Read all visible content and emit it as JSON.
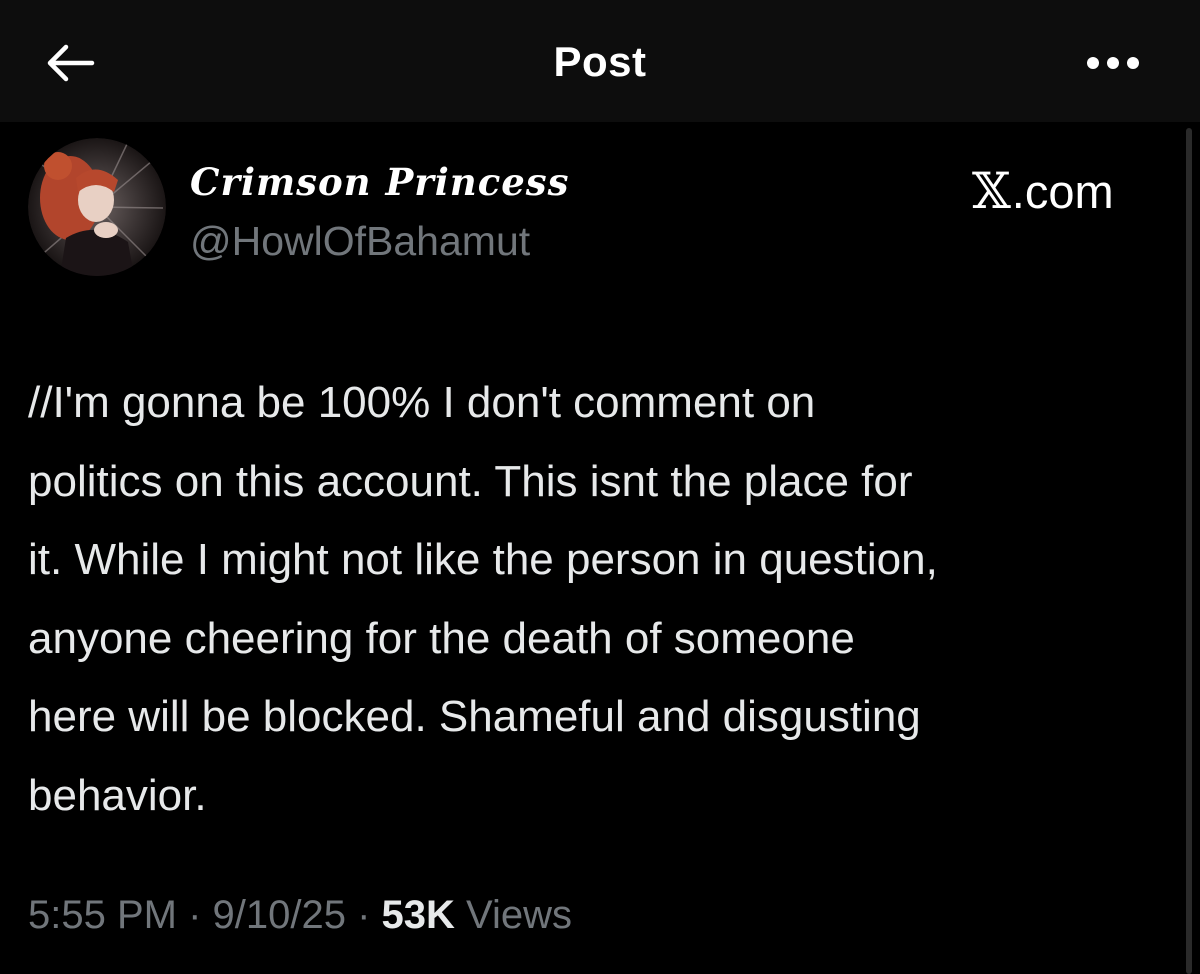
{
  "header": {
    "title": "Post"
  },
  "author": {
    "display_name": "Crimson Princess",
    "handle": "@HowlOfBahamut"
  },
  "source": {
    "label": ".com",
    "logo_icon": "x-logo-icon"
  },
  "post": {
    "text": "//I'm gonna be 100% I don't comment on\npolitics on this account. This isnt the place for\nit. While I might not like the person in question,\nanyone cheering for the death of someone\nhere will be blocked. Shameful and disgusting\nbehavior."
  },
  "meta": {
    "time": "5:55 PM",
    "separator": " · ",
    "date": "9/10/25",
    "views_count": "53K",
    "views_label": "Views"
  },
  "colors": {
    "background": "#000000",
    "text_primary": "#e7e9ea",
    "text_secondary": "#71767b"
  }
}
